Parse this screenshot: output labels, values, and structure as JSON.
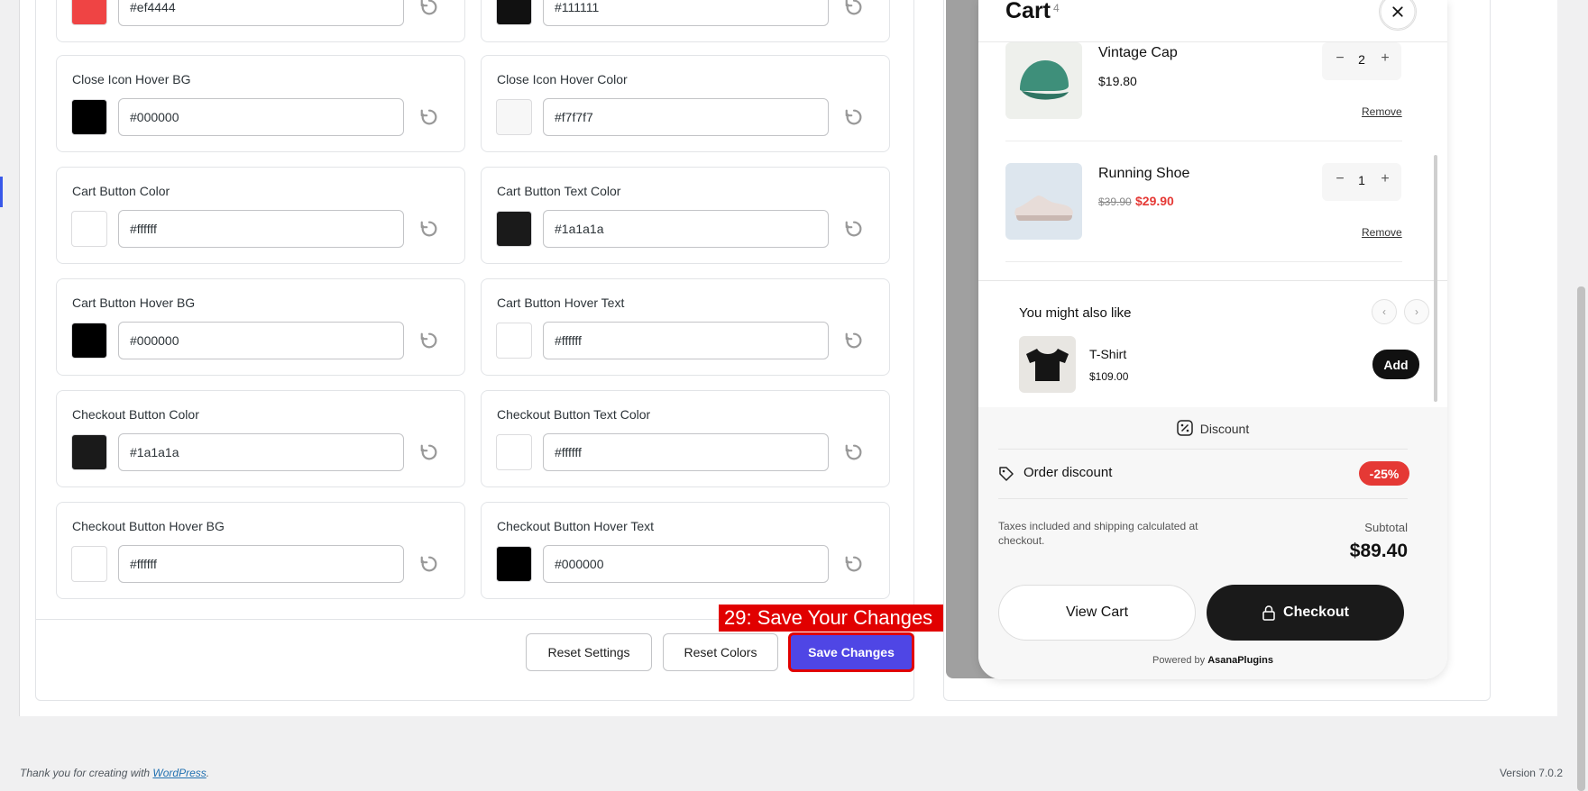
{
  "settings": {
    "partial_row": {
      "left_value": "#ef4444",
      "left_swatch": "#ef4444",
      "right_value": "#111111",
      "right_swatch": "#111111"
    },
    "fields": [
      {
        "label": "Close Icon Hover BG",
        "value": "#000000",
        "swatch": "#000000"
      },
      {
        "label": "Close Icon Hover Color",
        "value": "#f7f7f7",
        "swatch": "#f7f7f7"
      },
      {
        "label": "Cart Button Color",
        "value": "#ffffff",
        "swatch": "#ffffff"
      },
      {
        "label": "Cart Button Text Color",
        "value": "#1a1a1a",
        "swatch": "#1a1a1a"
      },
      {
        "label": "Cart Button Hover BG",
        "value": "#000000",
        "swatch": "#000000"
      },
      {
        "label": "Cart Button Hover Text",
        "value": "#ffffff",
        "swatch": "#ffffff"
      },
      {
        "label": "Checkout Button Color",
        "value": "#1a1a1a",
        "swatch": "#1a1a1a"
      },
      {
        "label": "Checkout Button Text Color",
        "value": "#ffffff",
        "swatch": "#ffffff"
      },
      {
        "label": "Checkout Button Hover BG",
        "value": "#ffffff",
        "swatch": "#ffffff"
      },
      {
        "label": "Checkout Button Hover Text",
        "value": "#000000",
        "swatch": "#000000"
      }
    ],
    "buttons": {
      "reset_settings": "Reset Settings",
      "reset_colors": "Reset Colors",
      "save_changes": "Save Changes"
    },
    "annotation": "29: Save Your Changes"
  },
  "cart": {
    "title": "Cart",
    "count": "4",
    "items": [
      {
        "name": "Vintage Cap",
        "price": "$19.80",
        "qty": "2",
        "remove": "Remove"
      },
      {
        "name": "Running Shoe",
        "old_price": "$39.90",
        "sale_price": "$29.90",
        "qty": "1",
        "remove": "Remove"
      }
    ],
    "upsell": {
      "title": "You might also like",
      "name": "T-Shirt",
      "price": "$109.00",
      "add_label": "Add"
    },
    "discount_heading": "Discount",
    "order_discount_label": "Order discount",
    "order_discount_value": "-25%",
    "tax_note": "Taxes included and shipping calculated at checkout.",
    "subtotal_label": "Subtotal",
    "subtotal_value": "$89.40",
    "view_cart_label": "View Cart",
    "checkout_label": "Checkout",
    "powered_prefix": "Powered by",
    "powered_brand": "AsanaPlugins"
  },
  "footer": {
    "thanks_prefix": "Thank you for creating with",
    "wp_link": "WordPress",
    "thanks_suffix": ".",
    "version": "Version 7.0.2"
  },
  "colors": {
    "accent": "#4f46e5",
    "annotation": "#e10000",
    "sale": "#e53935"
  }
}
